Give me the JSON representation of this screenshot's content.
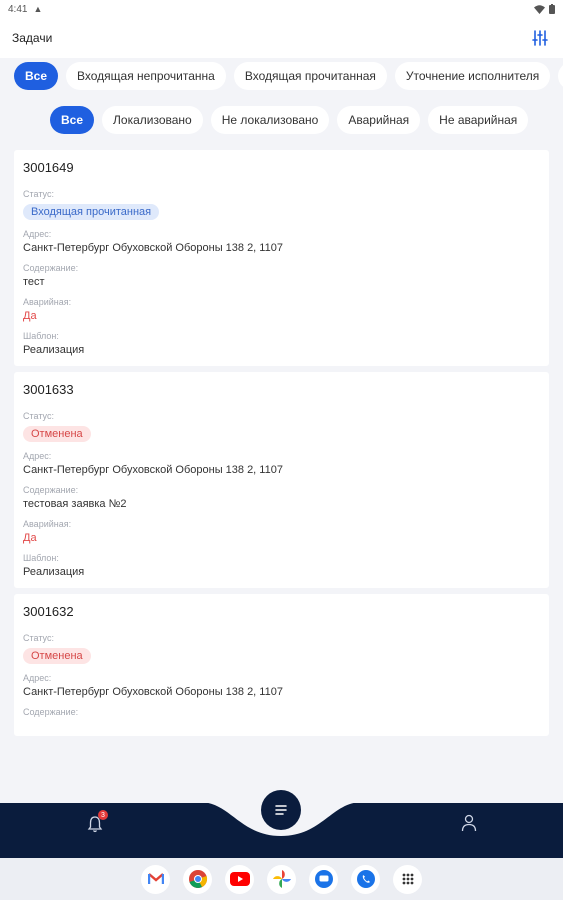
{
  "status_bar": {
    "time": "4:41"
  },
  "appbar": {
    "title": "Задачи",
    "filter_icon": "sliders-icon"
  },
  "filters_status": [
    "Все",
    "Входящая непрочитанна",
    "Входящая прочитанная",
    "Уточнение исполнителя",
    "В"
  ],
  "filters_type": [
    "Все",
    "Локализовано",
    "Не локализовано",
    "Аварийная",
    "Не аварийная"
  ],
  "labels": {
    "status": "Статус:",
    "address": "Адрес:",
    "content": "Содержание:",
    "emergency": "Аварийная:",
    "template": "Шаблон:"
  },
  "tasks": [
    {
      "number": "3001649",
      "status": "Входящая прочитанная",
      "address": "Санкт-Петербург Обуховской Обороны 138 2, 1107",
      "content": "тест",
      "emergency": "Да",
      "template": "Реализация"
    },
    {
      "number": "3001633",
      "status": "Отменена",
      "address": "Санкт-Петербург Обуховской Обороны 138 2, 1107",
      "content": "тестовая заявка №2",
      "emergency": "Да",
      "template": "Реализация"
    },
    {
      "number": "3001632",
      "status": "Отменена",
      "address": "Санкт-Петербург Обуховской Обороны 138 2, 1107",
      "content": ""
    }
  ],
  "bottom_nav": {
    "notification_count": "3"
  },
  "colors": {
    "accent": "#1f5fe0",
    "nav_bg": "#0a1c3d",
    "emergency": "#e24a4a"
  }
}
